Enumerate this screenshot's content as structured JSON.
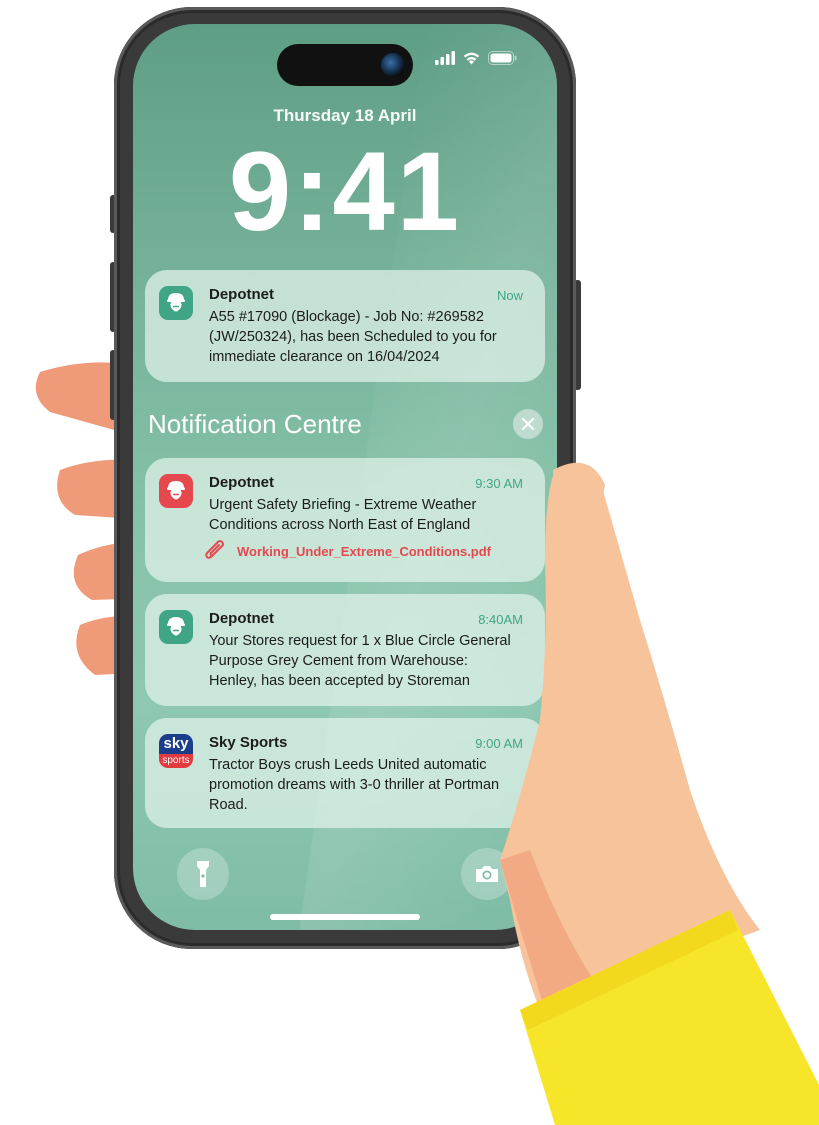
{
  "lock_screen": {
    "date": "Thursday 18 April",
    "time": "9:41"
  },
  "status_bar": {
    "icons": [
      "cellular-signal-icon",
      "wifi-icon",
      "battery-icon"
    ]
  },
  "top_notification": {
    "app": "Depotnet",
    "time": "Now",
    "text_lines": [
      "A55 #17090 (Blockage) - Job No: #269582",
      "(JW/250324), has been Scheduled to you for",
      "immediate clearance on 16/04/2024"
    ]
  },
  "notification_centre": {
    "title": "Notification Centre",
    "close_icon": "close-icon",
    "notifications": [
      {
        "app": "Depotnet",
        "time": "9:30 AM",
        "text_lines": [
          "Urgent Safety Briefing - Extreme Weather",
          "Conditions across North East of England"
        ],
        "attachment": "Working_Under_Extreme_Conditions.pdf",
        "icon_color": "#e5484d"
      },
      {
        "app": "Depotnet",
        "time": "8:40AM",
        "text_lines": [
          "Your Stores request for 1 x Blue Circle General",
          "Purpose Grey Cement from Warehouse:",
          "Henley, has been accepted by Storeman"
        ],
        "icon_color": "#3fa586"
      },
      {
        "app": "Sky Sports",
        "time": "9:00 AM",
        "text_lines": [
          "Tractor Boys crush Leeds United automatic",
          "promotion dreams with 3-0 thriller at Portman",
          "Road."
        ],
        "icon_text_top": "sky",
        "icon_text_bottom": "sports"
      }
    ]
  },
  "quick_actions": {
    "left": "flashlight-icon",
    "right": "camera-icon"
  },
  "colors": {
    "accent_green": "#3fa586",
    "alert_red": "#e5484d",
    "skin": "#f7c39a",
    "skin_shadow": "#ef9a78",
    "sleeve": "#f7e52a"
  }
}
